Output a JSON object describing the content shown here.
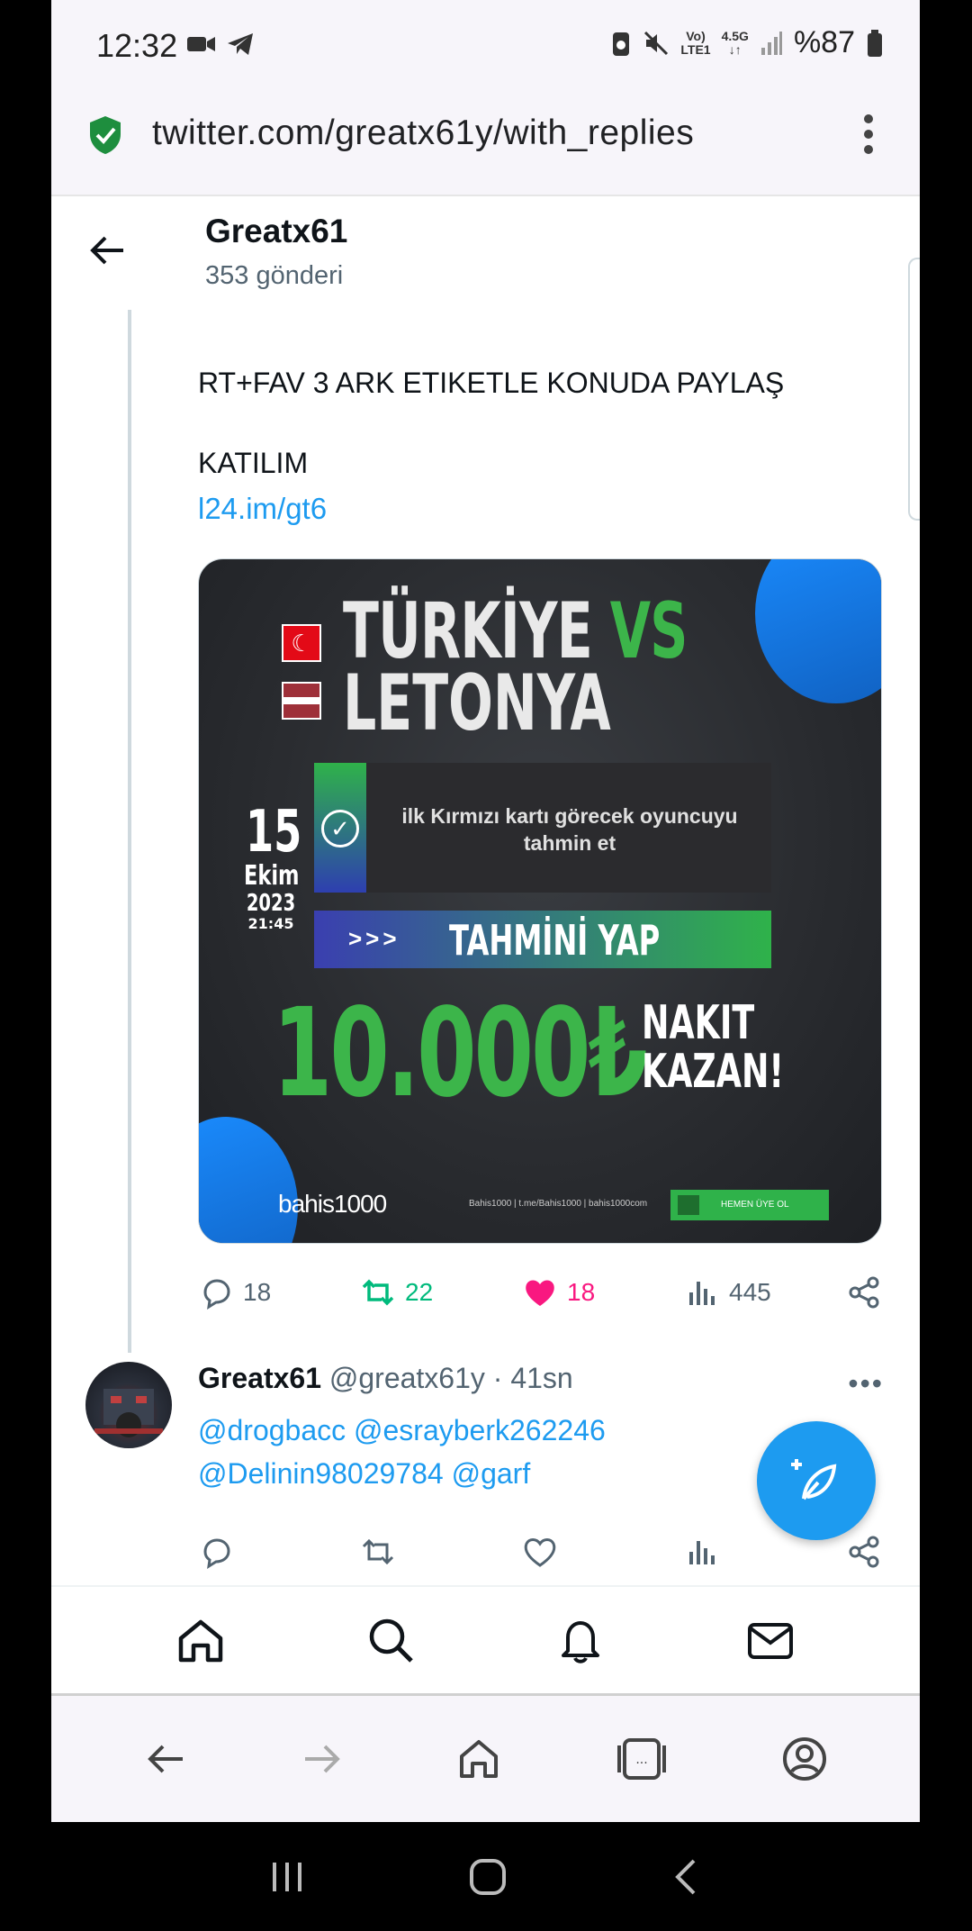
{
  "status_bar": {
    "time": "12:32",
    "net_top": "Vo)",
    "net_bottom": "LTE1",
    "net_type": "4.5G",
    "battery": "%87"
  },
  "browser": {
    "url": "twitter.com/greatx61y/with_replies"
  },
  "profile": {
    "name": "Greatx61",
    "post_count": "353 gönderi"
  },
  "tweet1": {
    "line1": "RT+FAV 3 ARK ETIKETLE KONUDA PAYLAŞ",
    "line2": "KATILIM",
    "link": "l24.im/gt6",
    "card": {
      "team1": "TÜRKİYE",
      "vs": "VS",
      "team2": "LETONYA",
      "flag1_symbol": "☾",
      "day": "15",
      "month": "Ekim",
      "year": "2023",
      "hour": "21:45",
      "box_text": "ilk Kırmızı kartı görecek oyuncuyu tahmin et",
      "arrows": ">>>",
      "button": "TAHMİNİ YAP",
      "amount": "10.000₺",
      "nakit": "NAKIT",
      "kazan": "KAZAN!",
      "brand": "bahis1000",
      "links": "Bahis1000 | t.me/Bahis1000 | bahis1000com",
      "cta": "HEMEN ÜYE OL"
    },
    "replies": "18",
    "retweets": "22",
    "likes": "18",
    "views": "445"
  },
  "tweet2": {
    "name": "Greatx61",
    "handle": "@greatx61y · 41sn",
    "more": "•••",
    "mentions_line1": "@drogbacc @esrayberk262246",
    "mentions_line2": "@Delinin98029784 @garf"
  },
  "colors": {
    "accent": "#1d9bf0",
    "retweet": "#00ba7c",
    "like": "#f91880",
    "muted": "#536471"
  }
}
